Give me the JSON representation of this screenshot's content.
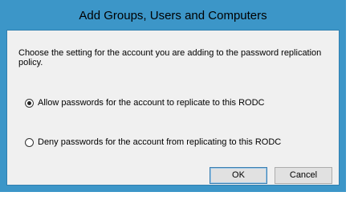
{
  "dialog": {
    "title": "Add Groups, Users and Computers",
    "instructions": "Choose the setting for the account you are adding to the password replication policy.",
    "options": [
      {
        "label": "Allow passwords for the account to replicate to this RODC",
        "selected": true
      },
      {
        "label": "Deny passwords for the account from replicating to this RODC",
        "selected": false
      }
    ],
    "ok_label": "OK",
    "cancel_label": "Cancel"
  },
  "colors": {
    "titlebar": "#3c96c8",
    "client_background": "#f0f0f0"
  }
}
